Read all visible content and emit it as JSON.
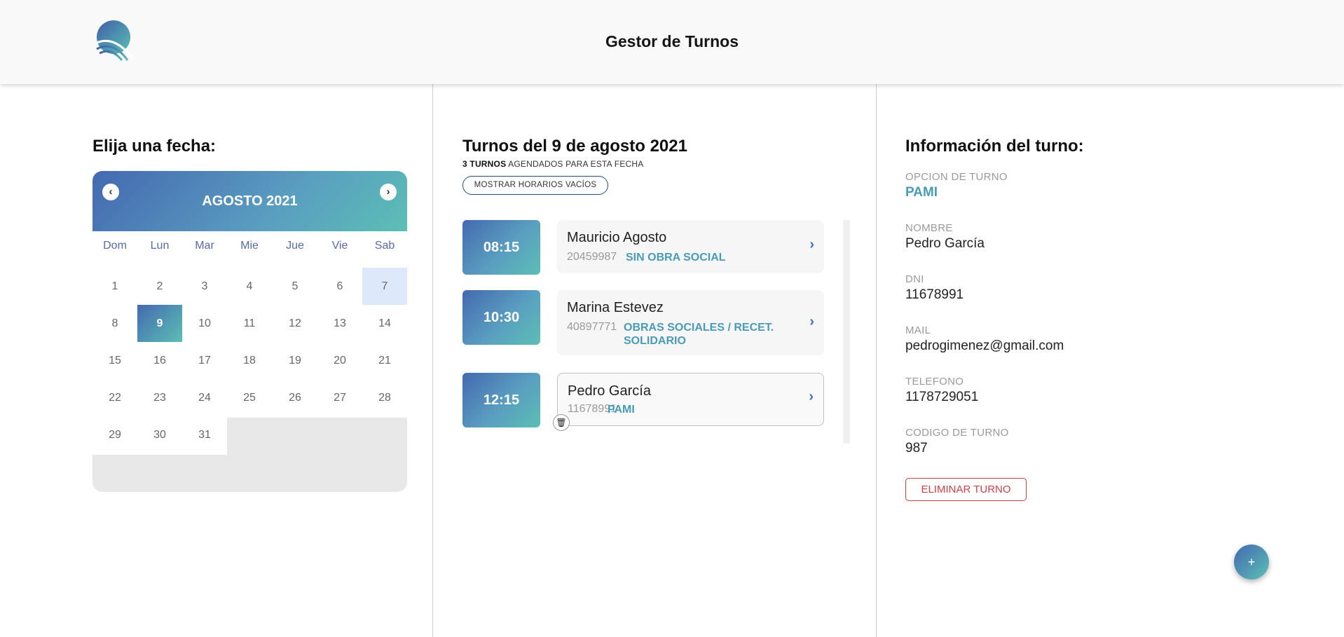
{
  "header": {
    "title": "Gestor de Turnos",
    "logo_icon": "q-logo-icon"
  },
  "calendar": {
    "section_title": "Elija una fecha:",
    "month_label": "AGOSTO 2021",
    "prev_icon": "chevron-left-icon",
    "next_icon": "chevron-right-icon",
    "weekdays": [
      "Dom",
      "Lun",
      "Mar",
      "Mie",
      "Jue",
      "Vie",
      "Sab"
    ],
    "weeks": [
      [
        "1",
        "2",
        "3",
        "4",
        "5",
        "6",
        "7"
      ],
      [
        "8",
        "9",
        "10",
        "11",
        "12",
        "13",
        "14"
      ],
      [
        "15",
        "16",
        "17",
        "18",
        "19",
        "20",
        "21"
      ],
      [
        "22",
        "23",
        "24",
        "25",
        "26",
        "27",
        "28"
      ],
      [
        "29",
        "30",
        "31"
      ]
    ],
    "selected_day": "9",
    "accent_gradient": [
      "#4469b0",
      "#5bbfb5"
    ]
  },
  "appointments": {
    "title": "Turnos del 9 de agosto 2021",
    "count_bold": "3 TURNOS",
    "count_rest": " AGENDADOS PARA ESTA FECHA",
    "show_empty_label": "MOSTRAR HORARIOS VACÍOS",
    "items": [
      {
        "time": "08:15",
        "name": "Mauricio Agosto",
        "dni": "20459987",
        "plan": "SIN OBRA SOCIAL",
        "arrow": "›"
      },
      {
        "time": "10:30",
        "name": "Marina Estevez",
        "dni": "40897771",
        "plan": "OBRAS SOCIALES / RECET. SOLIDARIO",
        "arrow": "›"
      },
      {
        "time": "12:15",
        "name": "Pedro García",
        "dni": "11678991",
        "plan": "PAMI",
        "arrow": "›"
      }
    ],
    "trash_icon": "trash-icon"
  },
  "details": {
    "title": "Información del turno:",
    "fields": [
      {
        "label": "OPCION DE TURNO",
        "value": "PAMI"
      },
      {
        "label": "NOMBRE",
        "value": "Pedro García"
      },
      {
        "label": "DNI",
        "value": "11678991"
      },
      {
        "label": "MAIL",
        "value": "pedrogimenez@gmail.com"
      },
      {
        "label": "TELEFONO",
        "value": "1178729051"
      },
      {
        "label": "CODIGO DE TURNO",
        "value": "987"
      }
    ],
    "delete_label": "ELIMINAR TURNO",
    "add_label": "+",
    "danger_color": "#c9424a",
    "plan_color": "#4a9bb5"
  }
}
